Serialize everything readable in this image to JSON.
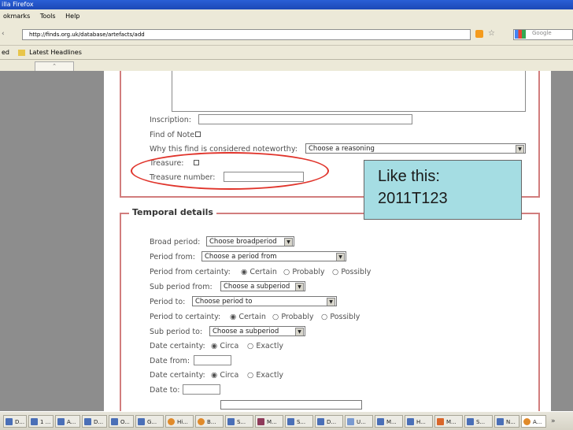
{
  "browser": {
    "title": "illa Firefox",
    "menu": [
      "okmarks",
      "Tools",
      "Help"
    ],
    "url": "http://finds.org.uk/database/artefacts/add",
    "search_placeholder": "Google",
    "bookmarks_bar": [
      "ed",
      "Latest Headlines"
    ]
  },
  "form": {
    "inscription_label": "Inscription:",
    "find_of_note_label": "Find of Note:",
    "why_noteworthy_label": "Why this find is considered noteworthy:",
    "why_noteworthy_value": "Choose a reasoning",
    "treasure_label": "Treasure:",
    "treasure_number_label": "Treasure number:"
  },
  "temporal": {
    "title": "Temporal details",
    "broad_period_label": "Broad period:",
    "broad_period_value": "Choose broadperiod",
    "period_from_label": "Period from:",
    "period_from_value": "Choose a period from",
    "period_from_certainty_label": "Period from certainty:",
    "certain": "Certain",
    "probably": "Probably",
    "possibly": "Possibly",
    "sub_period_from_label": "Sub period from:",
    "sub_period_from_value": "Choose a subperiod",
    "period_to_label": "Period to:",
    "period_to_value": "Choose period to",
    "period_to_certainty_label": "Period to certainty:",
    "sub_period_to_label": "Sub period to:",
    "sub_period_to_value": "Choose a subperiod",
    "date_certainty_label": "Date certainty:",
    "circa": "Circa",
    "exactly": "Exactly",
    "date_from_label": "Date from:",
    "date_to_label": "Date to:"
  },
  "callout": {
    "line1": "Like this:",
    "line2": "2011T123"
  },
  "taskbar": {
    "items": [
      "D...",
      "1 ...",
      "A...",
      "D...",
      "O...",
      "G...",
      "Hi...",
      "B...",
      "S...",
      "M...",
      "S...",
      "D...",
      "U...",
      "M...",
      "H...",
      "M...",
      "S...",
      "N...",
      "A..."
    ]
  },
  "colors": {
    "highlight_ellipse": "#e0342b",
    "callout_bg": "#a5dde3",
    "fieldset_border": "#d17d7d"
  }
}
